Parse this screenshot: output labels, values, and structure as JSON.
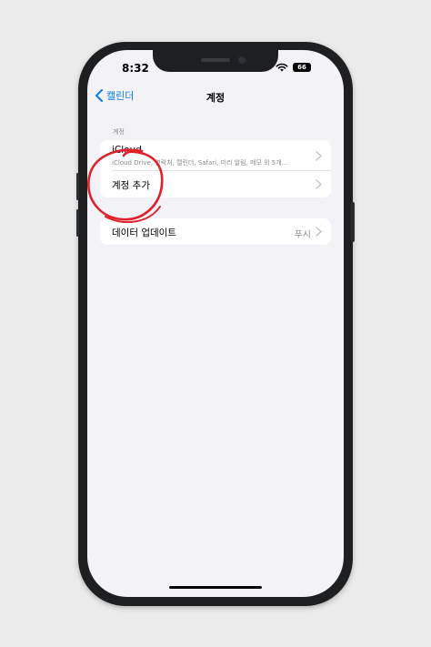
{
  "status_bar": {
    "time": "8:32",
    "battery_level": "66",
    "wifi_icon": "wifi-icon"
  },
  "nav": {
    "back_label": "캘린더",
    "title": "계정"
  },
  "accounts_section": {
    "header": "계정",
    "icloud": {
      "title": "iCloud",
      "subtitle": "iCloud Drive, 연락처, 캘린더, Safari, 미리 알림, 메모 외 5개..."
    },
    "add_account": {
      "title": "계정 추가"
    }
  },
  "data_update": {
    "title": "데이터 업데이트",
    "value": "푸시"
  },
  "colors": {
    "accent": "#0a7aff",
    "annotation": "#e0202a",
    "background": "#f2f2f7"
  }
}
